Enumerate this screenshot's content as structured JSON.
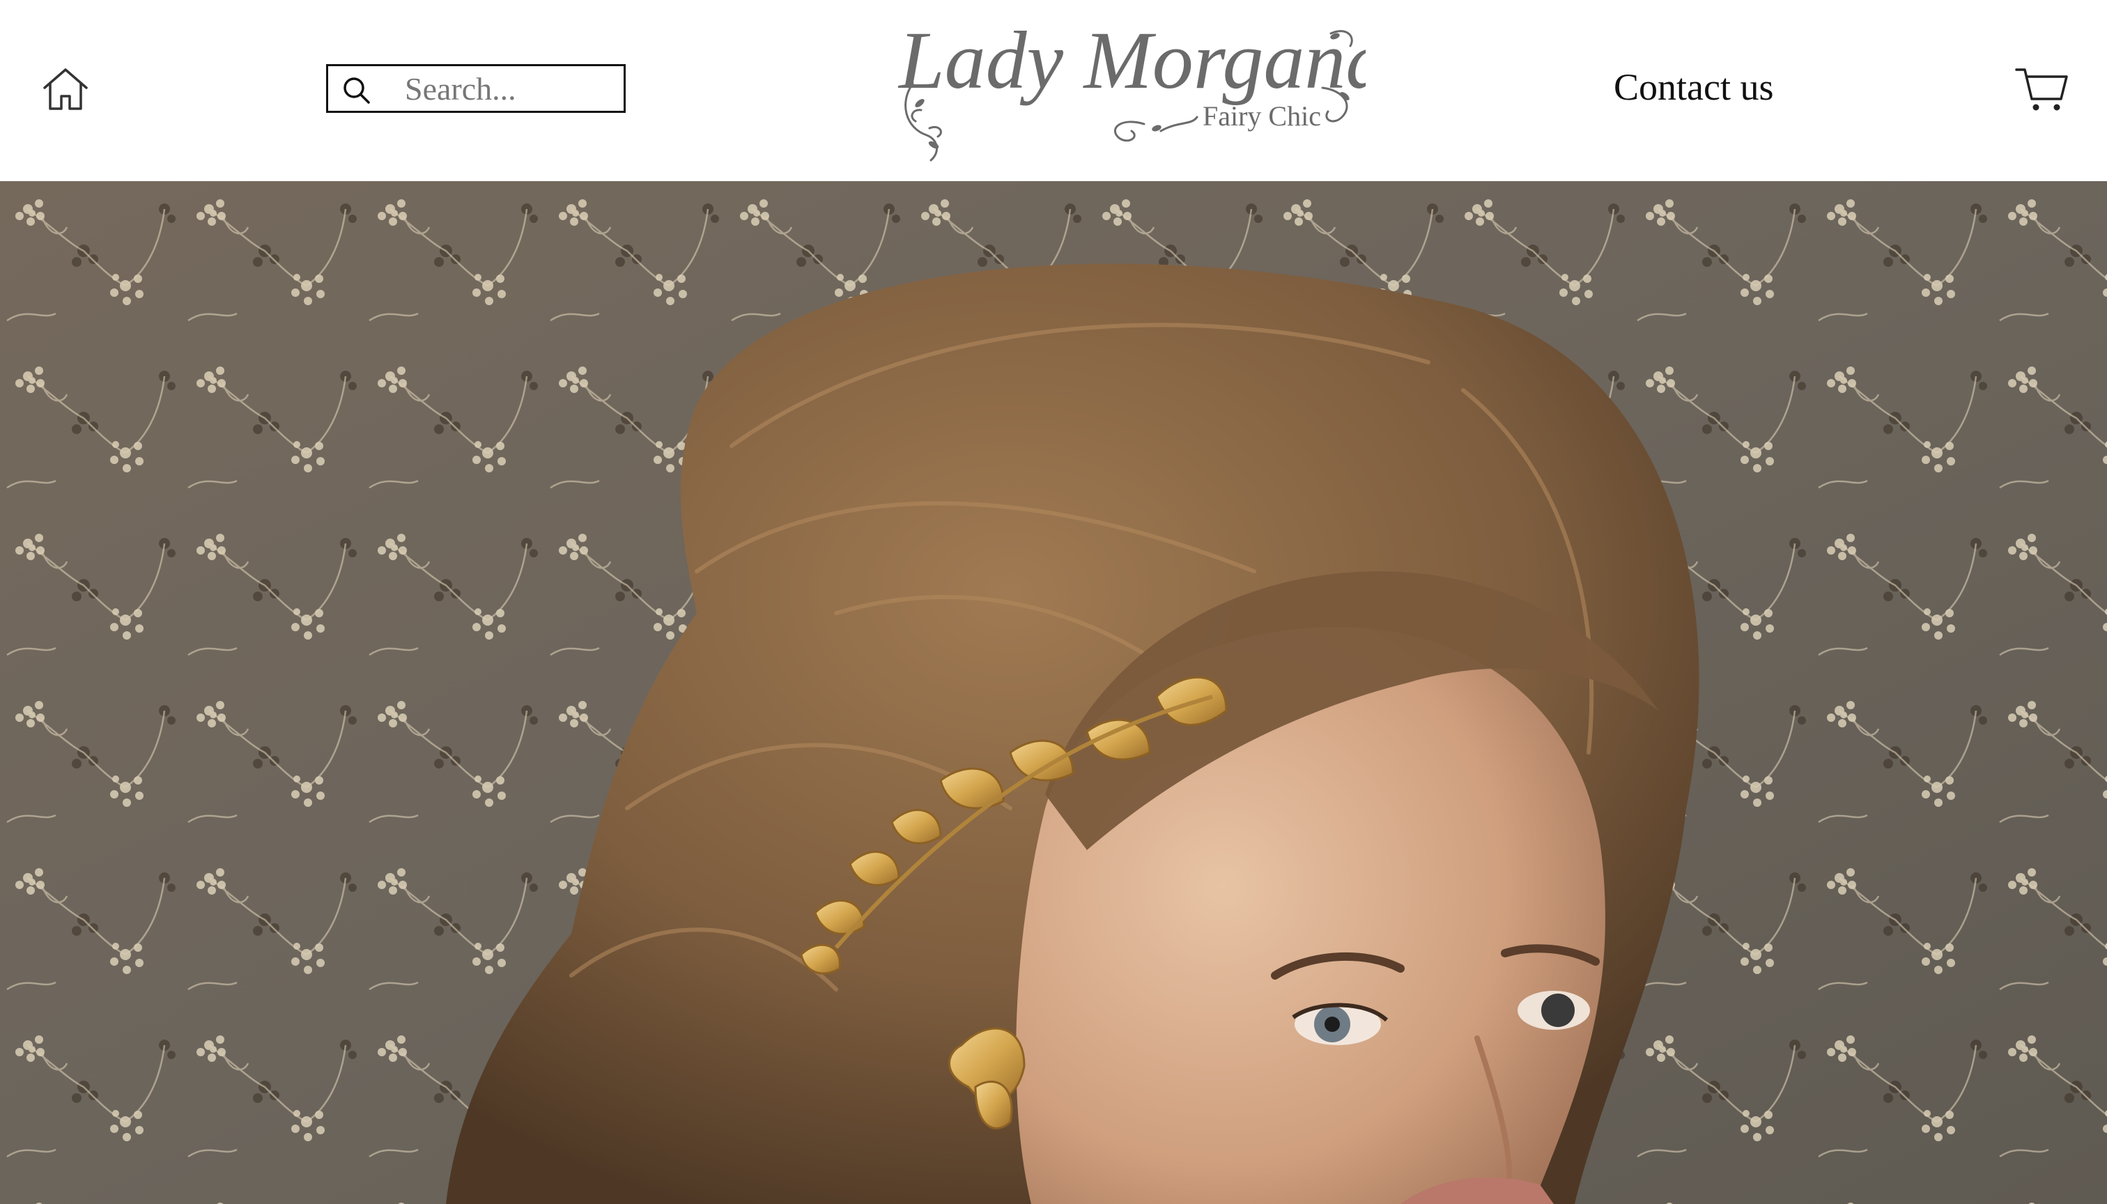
{
  "header": {
    "home_icon": "home-icon",
    "search": {
      "icon": "search-icon",
      "placeholder": "Search...",
      "value": ""
    },
    "logo": {
      "title": "Lady Morgana",
      "subtitle": "Fairy Chic"
    },
    "contact_label": "Contact us",
    "cart_icon": "cart-icon"
  },
  "colors": {
    "header_bg": "#ffffff",
    "text": "#111111",
    "logo_gray": "#6b6b6b",
    "hero_backdrop": "#6f665b",
    "hair": "#8a6a4a",
    "gold": "#d4a64e"
  }
}
